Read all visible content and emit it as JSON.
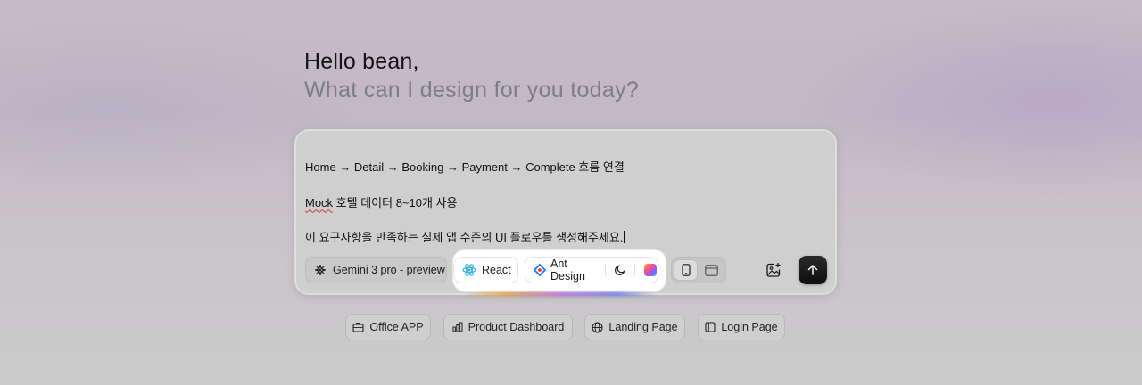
{
  "greeting": {
    "hello": "Hello bean,",
    "subtitle": "What can I design for you today?"
  },
  "prompt": {
    "line1": "Home → Detail → Booking → Payment → Complete 흐름 연결",
    "line2_word": "Mock",
    "line2_rest": " 호텔 데이터 8~10개 사용",
    "line3": "이 요구사항을 만족하는 실제 앱 수준의 UI 플로우를 생성해주세요."
  },
  "toolbar": {
    "model_label": "Gemini 3 pro - preview",
    "framework_label": "React",
    "ui_library_label": "Ant Design",
    "theme_icon": "moon-icon",
    "color_icon": "color-palette-icon",
    "device_options": [
      "mobile",
      "desktop"
    ],
    "device_selected": "mobile",
    "image_upload_icon": "image-add-icon",
    "send_icon": "arrow-up-icon"
  },
  "suggestions": [
    {
      "label": "Office APP",
      "icon": "briefcase-icon"
    },
    {
      "label": "Product Dashboard",
      "icon": "bar-chart-icon"
    },
    {
      "label": "Landing Page",
      "icon": "globe-icon"
    },
    {
      "label": "Login Page",
      "icon": "sidebar-layout-icon"
    }
  ],
  "colors": {
    "send_button": "#111111",
    "react_icon": "#1aa7d8",
    "ant_icon_primary": "#1677ff",
    "ant_icon_secondary": "#f5222d"
  }
}
